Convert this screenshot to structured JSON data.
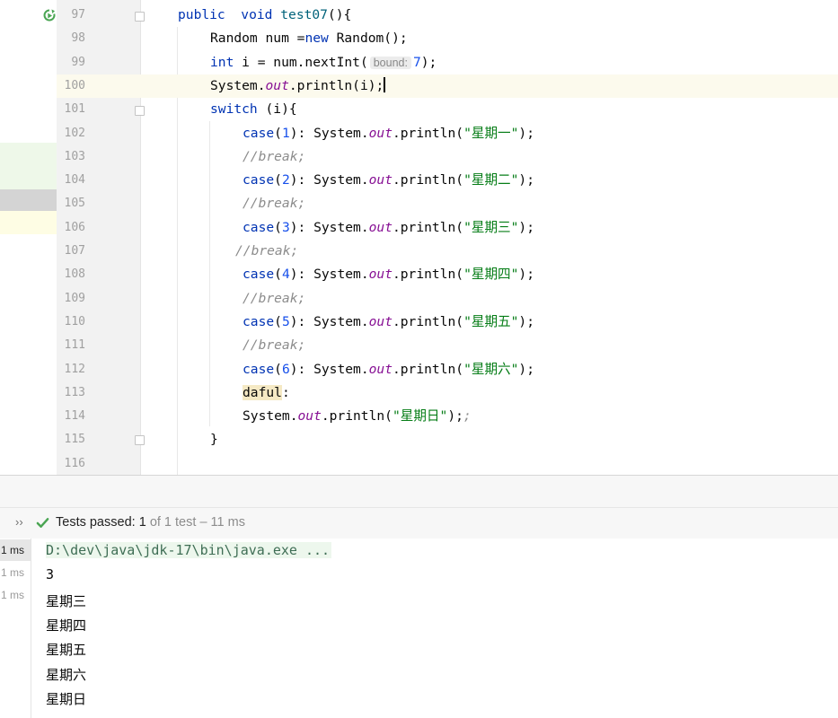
{
  "editor": {
    "lines": [
      {
        "num": "97",
        "tokens": [
          [
            "kw",
            "public"
          ],
          [
            "",
            "  "
          ],
          [
            "kw",
            "void"
          ],
          [
            "",
            " "
          ],
          [
            "fn",
            "test07"
          ],
          [
            "",
            "(){"
          ]
        ]
      },
      {
        "num": "98",
        "tokens": [
          [
            "",
            "Random num ="
          ],
          [
            "kw",
            "new"
          ],
          [
            "",
            " Random();"
          ]
        ]
      },
      {
        "num": "99",
        "tokens": [
          [
            "kw",
            "int"
          ],
          [
            "",
            " i = num.nextInt("
          ],
          [
            "hint",
            "bound:"
          ],
          [
            "num",
            "7"
          ],
          [
            "",
            ");"
          ]
        ]
      },
      {
        "num": "100",
        "tokens": [
          [
            "",
            "System."
          ],
          [
            "fld",
            "out"
          ],
          [
            "",
            ".println(i);"
          ]
        ]
      },
      {
        "num": "101",
        "tokens": [
          [
            "kw",
            "switch"
          ],
          [
            "",
            " (i){"
          ]
        ]
      },
      {
        "num": "102",
        "tokens": [
          [
            "kw",
            "case"
          ],
          [
            "",
            "("
          ],
          [
            "num",
            "1"
          ],
          [
            "",
            "): System."
          ],
          [
            "fld",
            "out"
          ],
          [
            "",
            ".println("
          ],
          [
            "str",
            "\"星期一\""
          ],
          [
            "",
            ");"
          ]
        ]
      },
      {
        "num": "103",
        "tokens": [
          [
            "cmt",
            "//break;"
          ]
        ]
      },
      {
        "num": "104",
        "tokens": [
          [
            "kw",
            "case"
          ],
          [
            "",
            "("
          ],
          [
            "num",
            "2"
          ],
          [
            "",
            "): System."
          ],
          [
            "fld",
            "out"
          ],
          [
            "",
            ".println("
          ],
          [
            "str",
            "\"星期二\""
          ],
          [
            "",
            ");"
          ]
        ]
      },
      {
        "num": "105",
        "tokens": [
          [
            "cmt",
            "//break;"
          ]
        ]
      },
      {
        "num": "106",
        "tokens": [
          [
            "kw",
            "case"
          ],
          [
            "",
            "("
          ],
          [
            "num",
            "3"
          ],
          [
            "",
            "): System."
          ],
          [
            "fld",
            "out"
          ],
          [
            "",
            ".println("
          ],
          [
            "str",
            "\"星期三\""
          ],
          [
            "",
            ");"
          ]
        ]
      },
      {
        "num": "107",
        "tokens": [
          [
            "cmt",
            "//break;"
          ]
        ]
      },
      {
        "num": "108",
        "tokens": [
          [
            "kw",
            "case"
          ],
          [
            "",
            "("
          ],
          [
            "num",
            "4"
          ],
          [
            "",
            "): System."
          ],
          [
            "fld",
            "out"
          ],
          [
            "",
            ".println("
          ],
          [
            "str",
            "\"星期四\""
          ],
          [
            "",
            ");"
          ]
        ]
      },
      {
        "num": "109",
        "tokens": [
          [
            "cmt",
            "//break;"
          ]
        ]
      },
      {
        "num": "110",
        "tokens": [
          [
            "kw",
            "case"
          ],
          [
            "",
            "("
          ],
          [
            "num",
            "5"
          ],
          [
            "",
            "): System."
          ],
          [
            "fld",
            "out"
          ],
          [
            "",
            ".println("
          ],
          [
            "str",
            "\"星期五\""
          ],
          [
            "",
            ");"
          ]
        ]
      },
      {
        "num": "111",
        "tokens": [
          [
            "cmt",
            "//break;"
          ]
        ]
      },
      {
        "num": "112",
        "tokens": [
          [
            "kw",
            "case"
          ],
          [
            "",
            "("
          ],
          [
            "num",
            "6"
          ],
          [
            "",
            "): System."
          ],
          [
            "fld",
            "out"
          ],
          [
            "",
            ".println("
          ],
          [
            "str",
            "\"星期六\""
          ],
          [
            "",
            ");"
          ]
        ]
      },
      {
        "num": "113",
        "tokens": [
          [
            "warn",
            "daful"
          ],
          [
            "",
            ":"
          ]
        ]
      },
      {
        "num": "114",
        "tokens": [
          [
            "",
            "System."
          ],
          [
            "fld",
            "out"
          ],
          [
            "",
            ".println("
          ],
          [
            "str",
            "\"星期日\""
          ],
          [
            "",
            ");"
          ],
          [
            "cmt",
            ";"
          ]
        ]
      },
      {
        "num": "115",
        "tokens": [
          [
            "",
            "}"
          ]
        ]
      },
      {
        "num": "116",
        "tokens": []
      }
    ]
  },
  "tests": {
    "status_label": "Tests passed:",
    "passed": "1",
    "of_text": "of 1 test",
    "duration_text": "– 11 ms"
  },
  "console": {
    "timings": [
      "1 ms",
      "1 ms",
      "1 ms"
    ],
    "command": "D:\\dev\\java\\jdk-17\\bin\\java.exe ...",
    "output": [
      "3",
      "星期三",
      "星期四",
      "星期五",
      "星期六",
      "星期日"
    ]
  },
  "colors": {
    "keyword": "#0033b3",
    "method": "#00627a",
    "field": "#871094",
    "string": "#067d17",
    "number": "#1750eb",
    "comment": "#8c8c8c",
    "current_line": "#fcfaed",
    "pass_green": "#4aa553"
  },
  "icons": {
    "run_gutter": "rerun-test-icon",
    "tests_status": "check-icon",
    "expand": "double-chevron-right-icon"
  }
}
